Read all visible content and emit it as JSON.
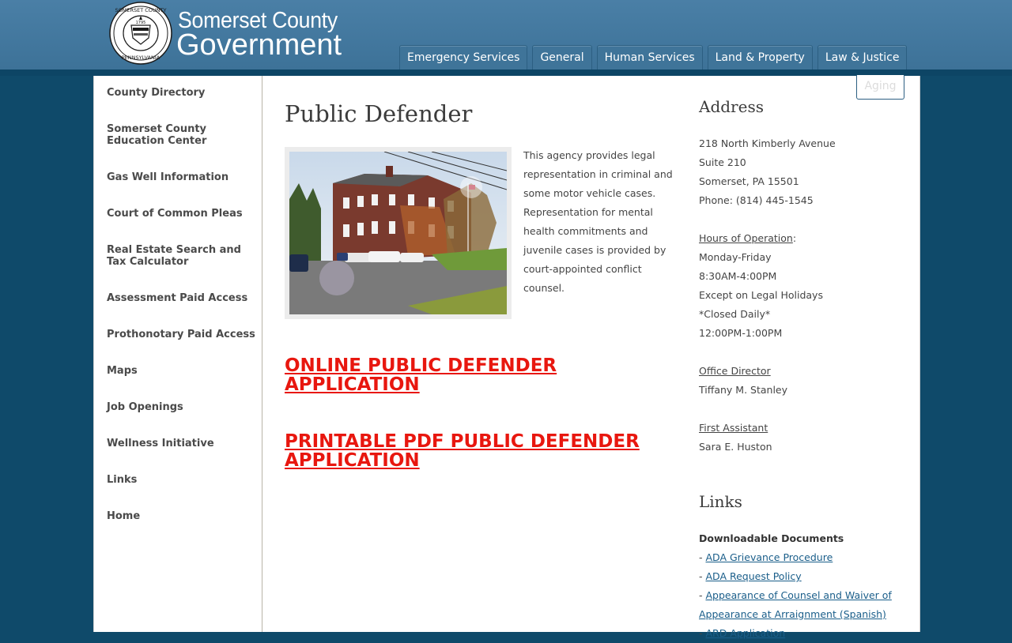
{
  "logo": {
    "line1": "Somerset County",
    "line2": "Government",
    "seal_top": "SOMERSET COUNTY",
    "seal_bottom": "PENNSYLVANIA",
    "seal_year": "1795"
  },
  "topnav": [
    "Emergency Services",
    "General",
    "Human Services",
    "Land & Property",
    "Law & Justice"
  ],
  "aging_tab": "Aging",
  "sidebar": [
    "County Directory",
    "Somerset County Education Center",
    "Gas Well Information",
    "Court of Common Pleas",
    "Real Estate Search and Tax Calculator",
    "Assessment Paid Access",
    "Prothonotary Paid Access",
    "Maps",
    "Job Openings",
    "Wellness Initiative",
    "Links",
    "Home"
  ],
  "main": {
    "title": "Public Defender",
    "intro": "This agency provides legal representation in criminal and some motor vehicle cases. Representation for mental health commitments and juvenile cases is provided by court-appointed conflict counsel.",
    "link_online": "ONLINE PUBLIC DEFENDER APPLICATION",
    "link_pdf": "PRINTABLE PDF PUBLIC DEFENDER APPLICATION"
  },
  "address": {
    "heading": "Address",
    "street": "218 North Kimberly Avenue",
    "suite": "Suite 210",
    "city": "Somerset, PA 15501",
    "phone": "Phone: (814) 445-1545",
    "hours_label": "Hours of Operation",
    "hours_colon": ":",
    "hours": [
      "Monday-Friday",
      "8:30AM-4:00PM",
      "Except on Legal Holidays",
      "*Closed Daily*",
      "12:00PM-1:00PM"
    ],
    "director_label": "Office Director",
    "director": "Tiffany M. Stanley",
    "assistant_label": "First Assistant",
    "assistant": "Sara E. Huston"
  },
  "links": {
    "heading": "Links",
    "docs_label": "Downloadable Documents",
    "dash": "- ",
    "items": [
      "ADA Grievance Procedure",
      "ADA Request Policy",
      "Appearance of Counsel and Waiver of",
      "Appearance at Arraignment (Spanish)",
      "ARD Application"
    ]
  }
}
